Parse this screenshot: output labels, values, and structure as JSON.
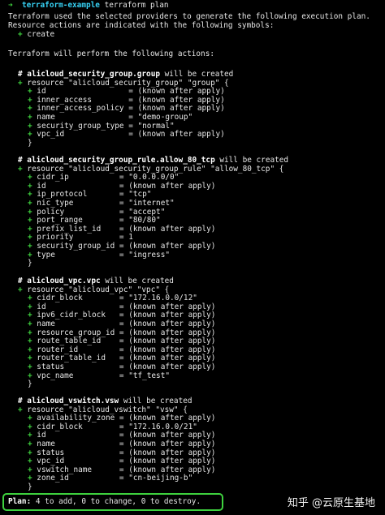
{
  "prompt": {
    "arrow": "➜",
    "directory": "terraform-example",
    "command": "terraform plan"
  },
  "intro": [
    "Terraform used the selected providers to generate the following execution plan.",
    "Resource actions are indicated with the following symbols:"
  ],
  "symbol_legend": {
    "symbol": "+",
    "label": "create"
  },
  "perform_text": "Terraform will perform the following actions:",
  "resources": [
    {
      "address": "alicloud_security_group.group",
      "will_text": "will be created",
      "decl": "+ resource \"alicloud_security_group\" \"group\" {",
      "attrs": [
        [
          "id",
          "= (known after apply)"
        ],
        [
          "inner_access",
          "= (known after apply)"
        ],
        [
          "inner_access_policy",
          "= (known after apply)"
        ],
        [
          "name",
          "= \"demo-group\""
        ],
        [
          "security_group_type",
          "= \"normal\""
        ],
        [
          "vpc_id",
          "= (known after apply)"
        ]
      ]
    },
    {
      "address": "alicloud_security_group_rule.allow_80_tcp",
      "will_text": "will be created",
      "decl": "+ resource \"alicloud_security_group_rule\" \"allow_80_tcp\" {",
      "attrs": [
        [
          "cidr_ip",
          "= \"0.0.0.0/0\""
        ],
        [
          "id",
          "= (known after apply)"
        ],
        [
          "ip_protocol",
          "= \"tcp\""
        ],
        [
          "nic_type",
          "= \"internet\""
        ],
        [
          "policy",
          "= \"accept\""
        ],
        [
          "port_range",
          "= \"80/80\""
        ],
        [
          "prefix_list_id",
          "= (known after apply)"
        ],
        [
          "priority",
          "= 1"
        ],
        [
          "security_group_id",
          "= (known after apply)"
        ],
        [
          "type",
          "= \"ingress\""
        ]
      ]
    },
    {
      "address": "alicloud_vpc.vpc",
      "will_text": "will be created",
      "decl": "+ resource \"alicloud_vpc\" \"vpc\" {",
      "attrs": [
        [
          "cidr_block",
          "= \"172.16.0.0/12\""
        ],
        [
          "id",
          "= (known after apply)"
        ],
        [
          "ipv6_cidr_block",
          "= (known after apply)"
        ],
        [
          "name",
          "= (known after apply)"
        ],
        [
          "resource_group_id",
          "= (known after apply)"
        ],
        [
          "route_table_id",
          "= (known after apply)"
        ],
        [
          "router_id",
          "= (known after apply)"
        ],
        [
          "router_table_id",
          "= (known after apply)"
        ],
        [
          "status",
          "= (known after apply)"
        ],
        [
          "vpc_name",
          "= \"tf_test\""
        ]
      ]
    },
    {
      "address": "alicloud_vswitch.vsw",
      "will_text": "will be created",
      "decl": "+ resource \"alicloud_vswitch\" \"vsw\" {",
      "attrs": [
        [
          "availability_zone",
          "= (known after apply)"
        ],
        [
          "cidr_block",
          "= \"172.16.0.0/21\""
        ],
        [
          "id",
          "= (known after apply)"
        ],
        [
          "name",
          "= (known after apply)"
        ],
        [
          "status",
          "= (known after apply)"
        ],
        [
          "vpc_id",
          "= (known after apply)"
        ],
        [
          "vswitch_name",
          "= (known after apply)"
        ],
        [
          "zone_id",
          "= \"cn-beijing-b\""
        ]
      ]
    }
  ],
  "plan_summary": {
    "label": "Plan:",
    "text": "4 to add, 0 to change, 0 to destroy."
  },
  "watermark": "知乎 @云原生基地",
  "colors": {
    "green": "#3fd23f",
    "cyan": "#37d2f5",
    "background": "#000000"
  }
}
